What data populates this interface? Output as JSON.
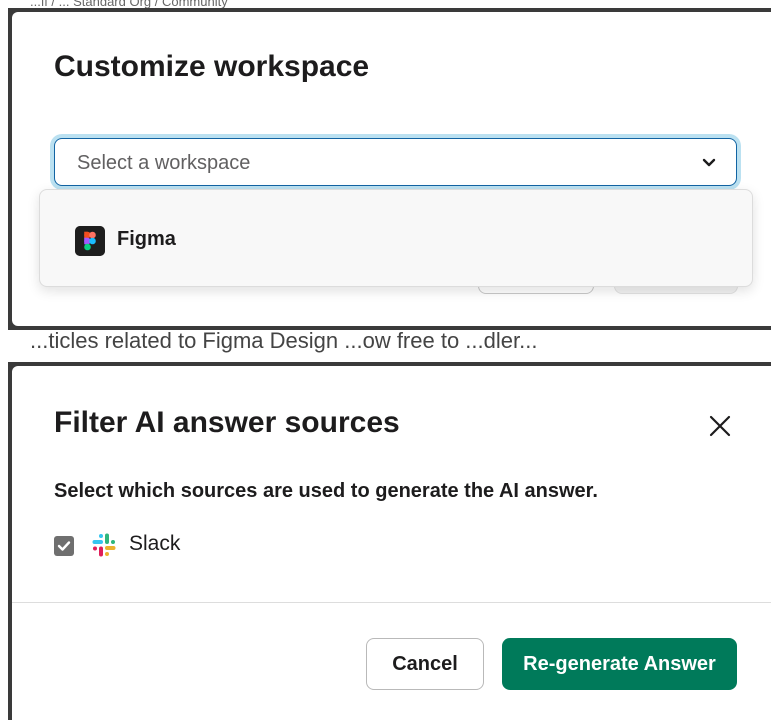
{
  "background": {
    "breadcrumb_text": "...ff / ... Standard Org / Community",
    "lower_text": "...ticles related to Figma Design ...ow free to ...dler..."
  },
  "customize_dialog": {
    "title": "Customize workspace",
    "select": {
      "placeholder": "Select a workspace",
      "icon": "chevron-down-icon"
    },
    "dropdown_options": [
      {
        "label": "Figma",
        "icon": "figma-logo"
      }
    ]
  },
  "filter_dialog": {
    "title": "Filter AI answer sources",
    "close_icon": "close-icon",
    "description": "Select which sources are used to generate the AI answer.",
    "sources": [
      {
        "label": "Slack",
        "checked": true,
        "icon": "slack-logo"
      }
    ],
    "buttons": {
      "cancel": "Cancel",
      "regenerate": "Re-generate Answer"
    }
  },
  "colors": {
    "primary_button": "#007a5a",
    "focus_border": "#1264a3",
    "checkbox": "#6f6f6f"
  }
}
